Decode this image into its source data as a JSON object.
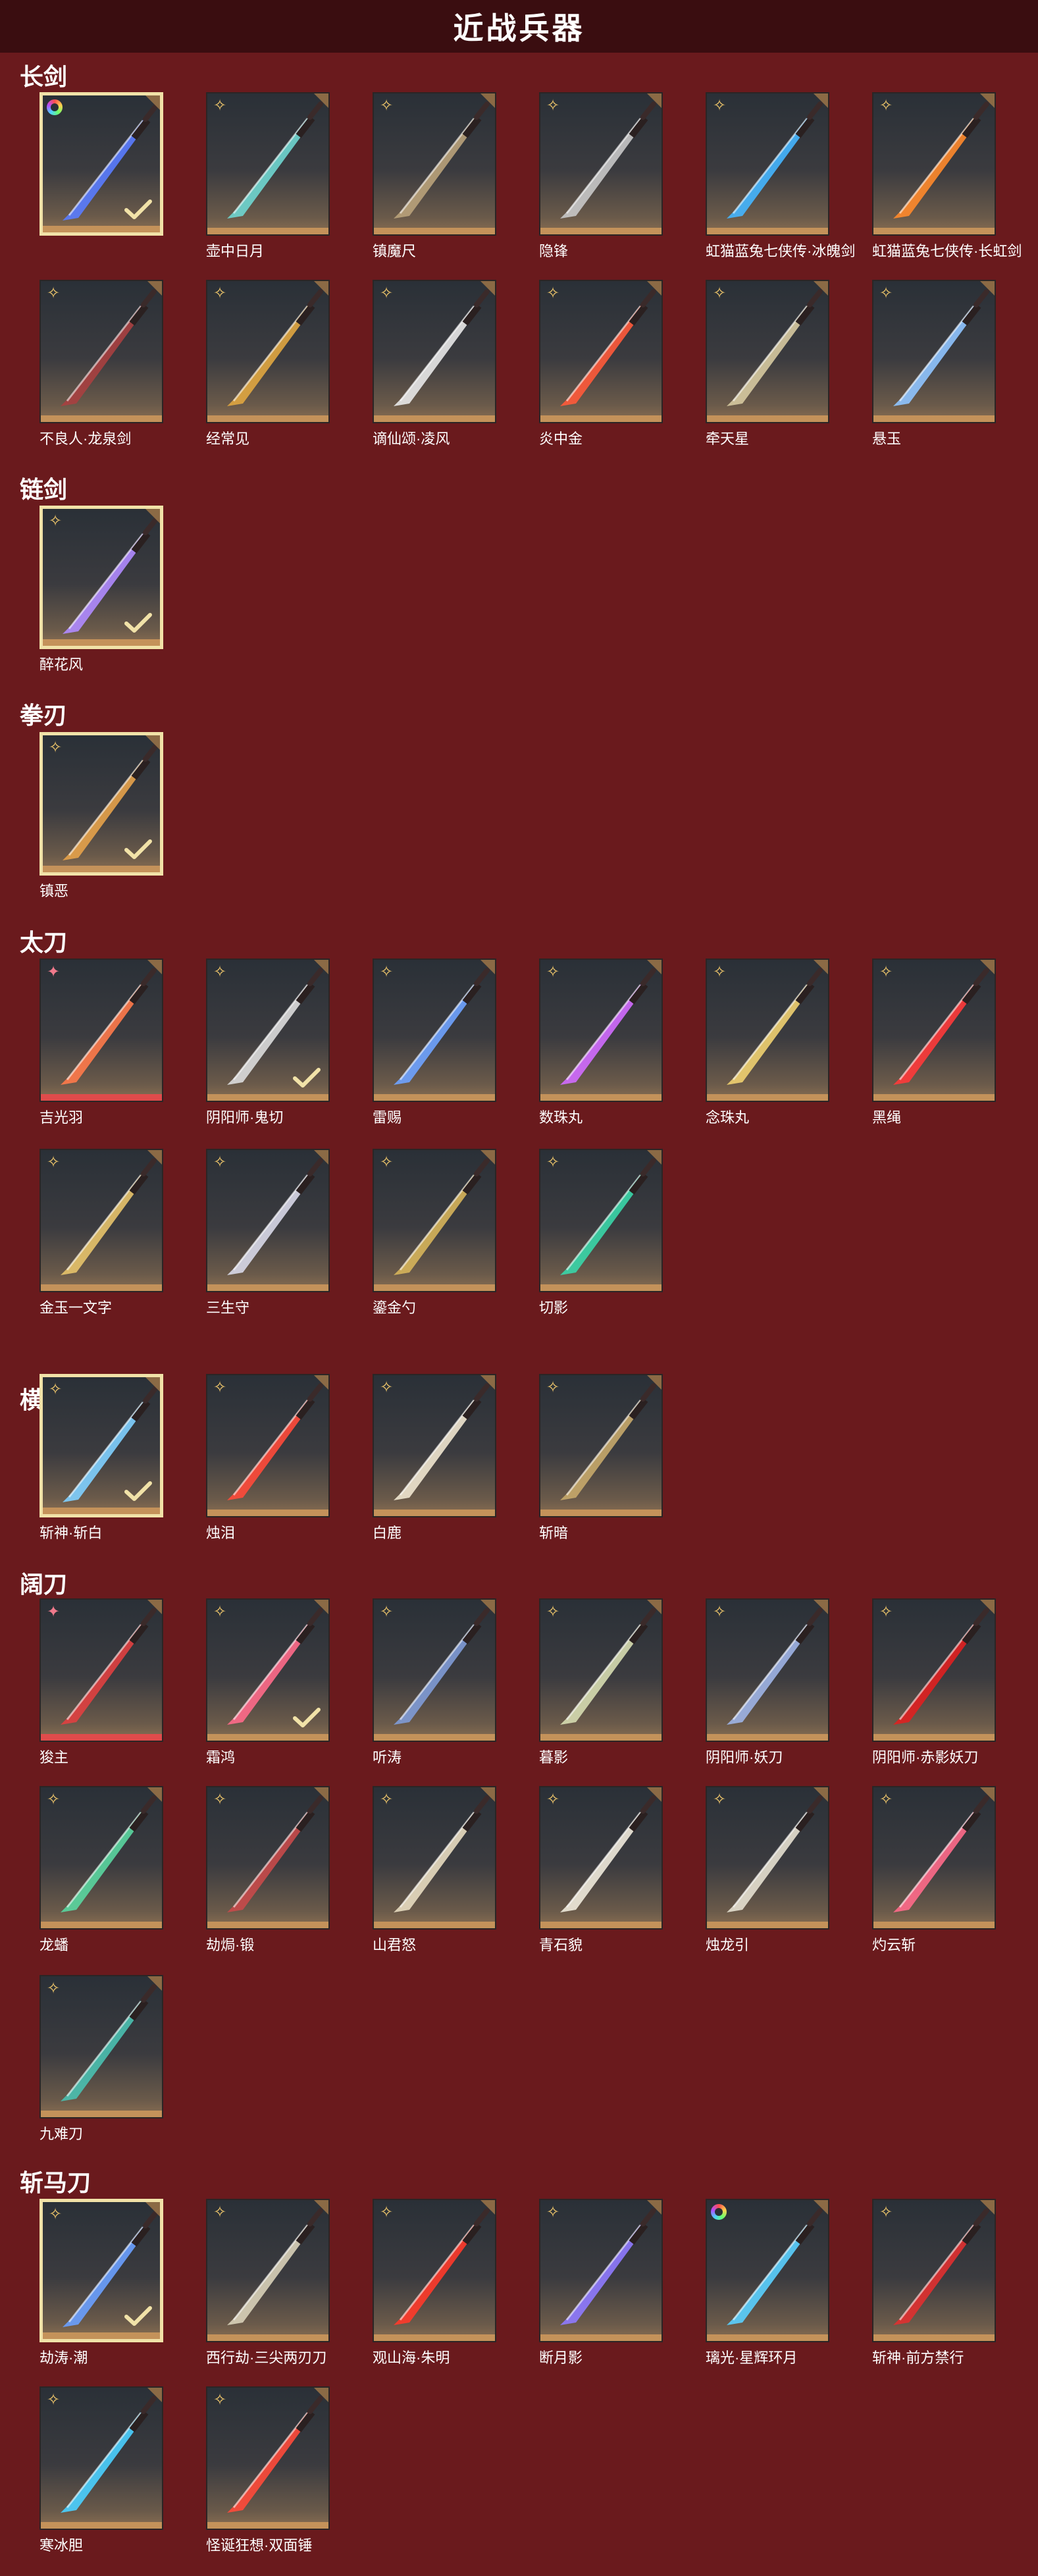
{
  "header": {
    "title": "近战兵器"
  },
  "categories": [
    {
      "name": "长剑",
      "items": [
        {
          "label": "",
          "badge": "rainbow",
          "selected": true,
          "weapon": "blue-sword",
          "color": "#5a7cff"
        },
        {
          "label": "壶中日月",
          "badge": "gold",
          "weapon": "teal-sword",
          "color": "#6fd6d0"
        },
        {
          "label": "镇魔尺",
          "badge": "gold",
          "weapon": "dark-sword",
          "color": "#b9a27a"
        },
        {
          "label": "隐锋",
          "badge": "gold",
          "weapon": "red-hilt-sword",
          "color": "#c8c8c8"
        },
        {
          "label": "虹猫蓝兔七侠传·冰魄剑",
          "badge": "gold",
          "weapon": "ice-sword",
          "color": "#45b6ff"
        },
        {
          "label": "虹猫蓝兔七侠传·长虹剑",
          "badge": "gold",
          "weapon": "flame-sword",
          "color": "#ff8a2b"
        },
        {
          "label": "不良人·龙泉剑",
          "badge": "gold",
          "weapon": "black-sword",
          "color": "#a84040"
        },
        {
          "label": "经常见",
          "badge": "gold",
          "weapon": "gold-sword",
          "color": "#e0a640"
        },
        {
          "label": "谪仙颂·凌风",
          "badge": "gold",
          "weapon": "white-sword",
          "color": "#e8e8e8"
        },
        {
          "label": "炎中金",
          "badge": "gold",
          "weapon": "ember-sword",
          "color": "#ff5a3a"
        },
        {
          "label": "牵天星",
          "badge": "gold",
          "weapon": "silver-sword",
          "color": "#d6c9a0"
        },
        {
          "label": "悬玉",
          "badge": "gold",
          "weapon": "jade-sword",
          "color": "#8fc4ff"
        }
      ]
    },
    {
      "name": "链剑",
      "items": [
        {
          "label": "醉花风",
          "badge": "gold",
          "selected": true,
          "weapon": "chain-sword",
          "color": "#b08bff"
        }
      ]
    },
    {
      "name": "拳刃",
      "items": [
        {
          "label": "镇恶",
          "badge": "gold",
          "selected": true,
          "weapon": "fist-blade",
          "color": "#e6a24a"
        }
      ]
    },
    {
      "name": "太刀",
      "items": [
        {
          "label": "吉光羽",
          "badge": "pink",
          "red": true,
          "weapon": "phoenix-katana",
          "color": "#ff7a4a"
        },
        {
          "label": "阴阳师·鬼切",
          "badge": "gold",
          "selected": false,
          "check": true,
          "weapon": "twin-katana",
          "color": "#dcdcdc"
        },
        {
          "label": "雷赐",
          "badge": "gold",
          "weapon": "thunder-katana",
          "color": "#6fa3ff"
        },
        {
          "label": "数珠丸",
          "badge": "gold",
          "weapon": "violet-katana",
          "color": "#d26bff"
        },
        {
          "label": "念珠丸",
          "badge": "gold",
          "weapon": "gold-katana",
          "color": "#f0d070"
        },
        {
          "label": "黑绳",
          "badge": "gold",
          "weapon": "crimson-katana",
          "color": "#ff3a3a"
        },
        {
          "label": "金玉一文字",
          "badge": "gold",
          "weapon": "gourd-katana",
          "color": "#e7c36a"
        },
        {
          "label": "三生守",
          "badge": "gold",
          "weapon": "pale-katana",
          "color": "#d8d8e8"
        },
        {
          "label": "鎏金勺",
          "badge": "gold",
          "weapon": "golden-spoon",
          "color": "#d6b45a"
        },
        {
          "label": "切影",
          "badge": "gold",
          "weapon": "shadow-katana",
          "color": "#3ad6a8"
        }
      ]
    },
    {
      "name": "横刀",
      "items": [
        {
          "label": "斩神·斩白",
          "badge": "gold",
          "selected": true,
          "weapon": "white-saber",
          "color": "#7fd0ff"
        },
        {
          "label": "烛泪",
          "badge": "gold",
          "weapon": "red-saber",
          "color": "#ff4a3a"
        },
        {
          "label": "白鹿",
          "badge": "gold",
          "weapon": "deer-saber",
          "color": "#efe6cf"
        },
        {
          "label": "斩暗",
          "badge": "gold",
          "weapon": "bronze-saber",
          "color": "#c6a96a"
        }
      ]
    },
    {
      "name": "阔刀",
      "items": [
        {
          "label": "狻主",
          "badge": "pink",
          "red": true,
          "weapon": "beast-blade",
          "color": "#e04040"
        },
        {
          "label": "霜鸿",
          "badge": "gold",
          "check": true,
          "weapon": "frost-blade",
          "color": "#ff6a8a"
        },
        {
          "label": "听涛",
          "badge": "gold",
          "weapon": "wave-blade",
          "color": "#7f9bd6"
        },
        {
          "label": "暮影",
          "badge": "gold",
          "weapon": "twilight-blade",
          "color": "#d6dcb0"
        },
        {
          "label": "阴阳师·妖刀",
          "badge": "gold",
          "weapon": "demon-blade",
          "color": "#9fb4e6"
        },
        {
          "label": "阴阳师·赤影妖刀",
          "badge": "gold",
          "weapon": "crimson-blade",
          "color": "#e02020"
        },
        {
          "label": "龙蟠",
          "badge": "gold",
          "weapon": "dragon-blade",
          "color": "#5ad6a0"
        },
        {
          "label": "劫焗·锻",
          "badge": "gold",
          "weapon": "forge-blade",
          "color": "#c84a4a"
        },
        {
          "label": "山君怒",
          "badge": "gold",
          "weapon": "tiger-blade",
          "color": "#e8dcc0"
        },
        {
          "label": "青石貌",
          "badge": "gold",
          "weapon": "stone-blade",
          "color": "#f0eadc"
        },
        {
          "label": "烛龙引",
          "badge": "gold",
          "weapon": "candle-blade",
          "color": "#e6e0d0"
        },
        {
          "label": "灼云斩",
          "badge": "gold",
          "weapon": "cloud-blade",
          "color": "#ff6a8a"
        },
        {
          "label": "九难刀",
          "badge": "gold",
          "weapon": "nine-blade",
          "color": "#4ac0b0"
        }
      ]
    },
    {
      "name": "斩马刀",
      "items": [
        {
          "label": "劫涛·潮",
          "badge": "gold",
          "selected": true,
          "weapon": "tide-glaive",
          "color": "#6aa0ff"
        },
        {
          "label": "西行劫·三尖两刃刀",
          "badge": "gold",
          "weapon": "trident-glaive",
          "color": "#d8d0b8"
        },
        {
          "label": "观山海·朱明",
          "badge": "gold",
          "weapon": "scarlet-glaive",
          "color": "#ff3a2a"
        },
        {
          "label": "断月影",
          "badge": "gold",
          "weapon": "moon-glaive",
          "color": "#8f7aff"
        },
        {
          "label": "璃光·星辉环月",
          "badge": "rainbow",
          "weapon": "star-glaive",
          "color": "#5ad0ff"
        },
        {
          "label": "斩神·前方禁行",
          "badge": "gold",
          "weapon": "sign-glaive",
          "color": "#e03030"
        },
        {
          "label": "寒冰胆",
          "badge": "gold",
          "weapon": "ice-glaive",
          "color": "#4ad0ff"
        },
        {
          "label": "怪诞狂想·双面锤",
          "badge": "gold",
          "weapon": "clown-hammer",
          "color": "#ff4a3a"
        }
      ]
    }
  ]
}
